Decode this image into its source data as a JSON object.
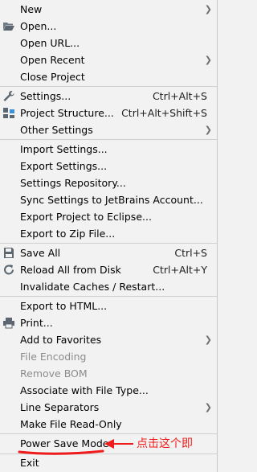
{
  "menu": {
    "items": [
      {
        "label": "New",
        "shortcut": "",
        "submenu": true,
        "icon": "",
        "disabled": false
      },
      {
        "label": "Open...",
        "shortcut": "",
        "submenu": false,
        "icon": "folder-open-icon",
        "disabled": false
      },
      {
        "label": "Open URL...",
        "shortcut": "",
        "submenu": false,
        "icon": "",
        "disabled": false
      },
      {
        "label": "Open Recent",
        "shortcut": "",
        "submenu": true,
        "icon": "",
        "disabled": false
      },
      {
        "label": "Close Project",
        "shortcut": "",
        "submenu": false,
        "icon": "",
        "disabled": false
      },
      {
        "label": "Settings...",
        "shortcut": "Ctrl+Alt+S",
        "submenu": false,
        "icon": "wrench-icon",
        "disabled": false
      },
      {
        "label": "Project Structure...",
        "shortcut": "Ctrl+Alt+Shift+S",
        "submenu": false,
        "icon": "project-structure-icon",
        "disabled": false
      },
      {
        "label": "Other Settings",
        "shortcut": "",
        "submenu": true,
        "icon": "",
        "disabled": false
      },
      {
        "label": "Import Settings...",
        "shortcut": "",
        "submenu": false,
        "icon": "",
        "disabled": false
      },
      {
        "label": "Export Settings...",
        "shortcut": "",
        "submenu": false,
        "icon": "",
        "disabled": false
      },
      {
        "label": "Settings Repository...",
        "shortcut": "",
        "submenu": false,
        "icon": "",
        "disabled": false
      },
      {
        "label": "Sync Settings to JetBrains Account...",
        "shortcut": "",
        "submenu": false,
        "icon": "",
        "disabled": false
      },
      {
        "label": "Export Project to Eclipse...",
        "shortcut": "",
        "submenu": false,
        "icon": "",
        "disabled": false
      },
      {
        "label": "Export to Zip File...",
        "shortcut": "",
        "submenu": false,
        "icon": "",
        "disabled": false
      },
      {
        "label": "Save All",
        "shortcut": "Ctrl+S",
        "submenu": false,
        "icon": "save-icon",
        "disabled": false
      },
      {
        "label": "Reload All from Disk",
        "shortcut": "Ctrl+Alt+Y",
        "submenu": false,
        "icon": "reload-icon",
        "disabled": false
      },
      {
        "label": "Invalidate Caches / Restart...",
        "shortcut": "",
        "submenu": false,
        "icon": "",
        "disabled": false
      },
      {
        "label": "Export to HTML...",
        "shortcut": "",
        "submenu": false,
        "icon": "",
        "disabled": false
      },
      {
        "label": "Print...",
        "shortcut": "",
        "submenu": false,
        "icon": "printer-icon",
        "disabled": false
      },
      {
        "label": "Add to Favorites",
        "shortcut": "",
        "submenu": true,
        "icon": "",
        "disabled": false
      },
      {
        "label": "File Encoding",
        "shortcut": "",
        "submenu": false,
        "icon": "",
        "disabled": true
      },
      {
        "label": "Remove BOM",
        "shortcut": "",
        "submenu": false,
        "icon": "",
        "disabled": true
      },
      {
        "label": "Associate with File Type...",
        "shortcut": "",
        "submenu": false,
        "icon": "",
        "disabled": false
      },
      {
        "label": "Line Separators",
        "shortcut": "",
        "submenu": true,
        "icon": "",
        "disabled": false
      },
      {
        "label": "Make File Read-Only",
        "shortcut": "",
        "submenu": false,
        "icon": "",
        "disabled": false
      },
      {
        "label": "Power Save Mode",
        "shortcut": "",
        "submenu": false,
        "icon": "",
        "disabled": false
      },
      {
        "label": "Exit",
        "shortcut": "",
        "submenu": false,
        "icon": "",
        "disabled": false
      }
    ]
  },
  "annotation": {
    "text": "点击这个即",
    "color": "#ee1c1c"
  }
}
